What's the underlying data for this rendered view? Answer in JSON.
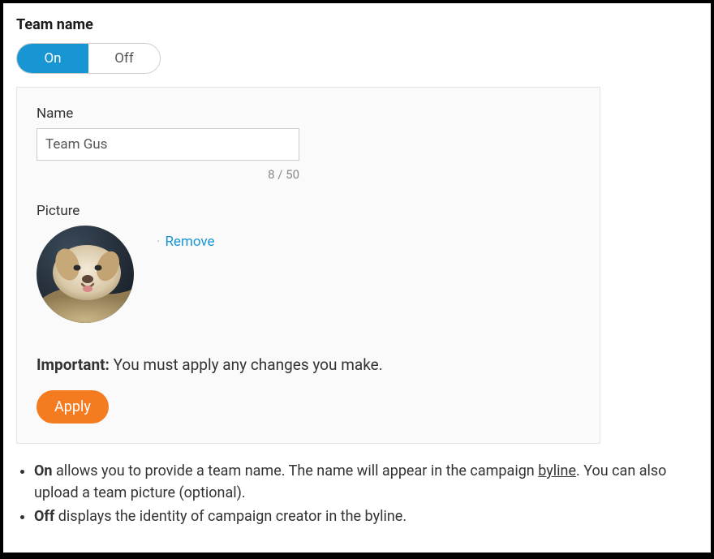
{
  "title": "Team name",
  "toggle": {
    "on": "On",
    "off": "Off"
  },
  "name_field": {
    "label": "Name",
    "value": "Team Gus",
    "counter": "8 / 50"
  },
  "picture_field": {
    "label": "Picture",
    "remove": "Remove"
  },
  "important": {
    "label": "Important:",
    "text": " You must apply any changes you make."
  },
  "apply_label": "Apply",
  "notes": {
    "on_bold": "On",
    "on_text_a": " allows you to provide a team name. The name will appear in the campaign ",
    "byline": "byline",
    "on_text_b": ". You can also upload a team picture (optional).",
    "off_bold": "Off",
    "off_text": " displays the identity of campaign creator in the byline."
  }
}
